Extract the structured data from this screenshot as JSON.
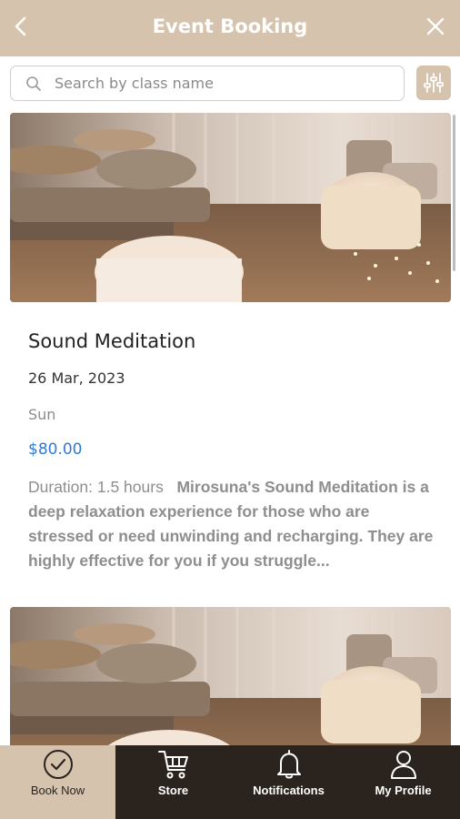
{
  "header": {
    "title": "Event Booking",
    "bg_color": "#d6c3ae"
  },
  "search": {
    "placeholder": "Search by class name"
  },
  "events": [
    {
      "title": "Sound Meditation",
      "date": "26 Mar, 2023",
      "day": "Sun",
      "price": "$80.00",
      "duration": "Duration: 1.5 hours",
      "description": "Mirosuna's Sound Meditation is a deep relaxation experience for those who are stressed or need unwinding and recharging. They are highly effective for you if you struggle..."
    }
  ],
  "nav": [
    {
      "label": "Book Now",
      "icon": "check-circle-icon",
      "active": true
    },
    {
      "label": "Store",
      "icon": "cart-icon",
      "active": false
    },
    {
      "label": "Notifications",
      "icon": "bell-icon",
      "active": false
    },
    {
      "label": "My Profile",
      "icon": "user-icon",
      "active": false
    }
  ],
  "colors": {
    "accent": "#d6c3ae",
    "nav_bg": "#2b241e",
    "price": "#2e7bd6"
  }
}
